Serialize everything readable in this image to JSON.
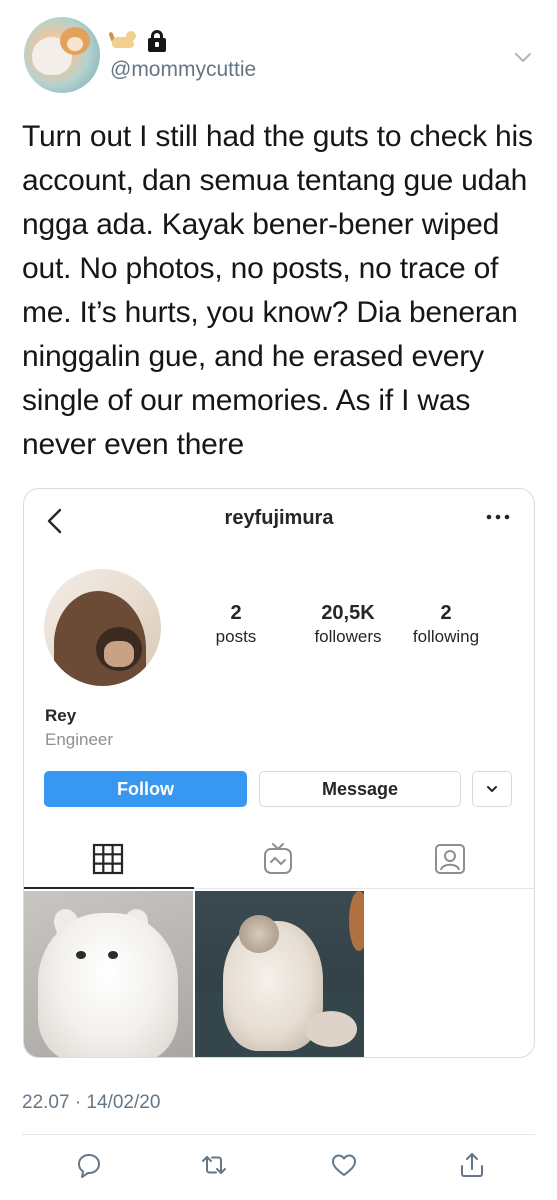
{
  "tweet": {
    "emoji": [
      "cat-emoji",
      "lock-emoji"
    ],
    "handle": "@mommycuttie",
    "text": "Turn out I still had the guts to check his account, dan semua tentang gue udah ngga ada. Kayak bener-bener wiped out. No photos, no posts, no trace of me. It’s hurts, you know? Dia beneran ninggalin gue, and he erased every single of our memories. As if I was never even there",
    "timestamp": "22.07 · 14/02/20",
    "actions": [
      "reply-icon",
      "retweet-icon",
      "like-icon",
      "share-icon"
    ]
  },
  "instagram": {
    "username": "reyfujimura",
    "stats": {
      "posts_count": "2",
      "posts_label": "posts",
      "followers_count": "20,5K",
      "followers_label": "followers",
      "following_count": "2",
      "following_label": "following"
    },
    "name": "Rey",
    "bio": "Engineer",
    "follow_label": "Follow",
    "message_label": "Message",
    "tabs": [
      "grid-icon",
      "igtv-icon",
      "tagged-icon"
    ]
  },
  "colors": {
    "follow_blue": "#3897f0",
    "twitter_gray": "#657786",
    "text_dark": "#14171a"
  }
}
